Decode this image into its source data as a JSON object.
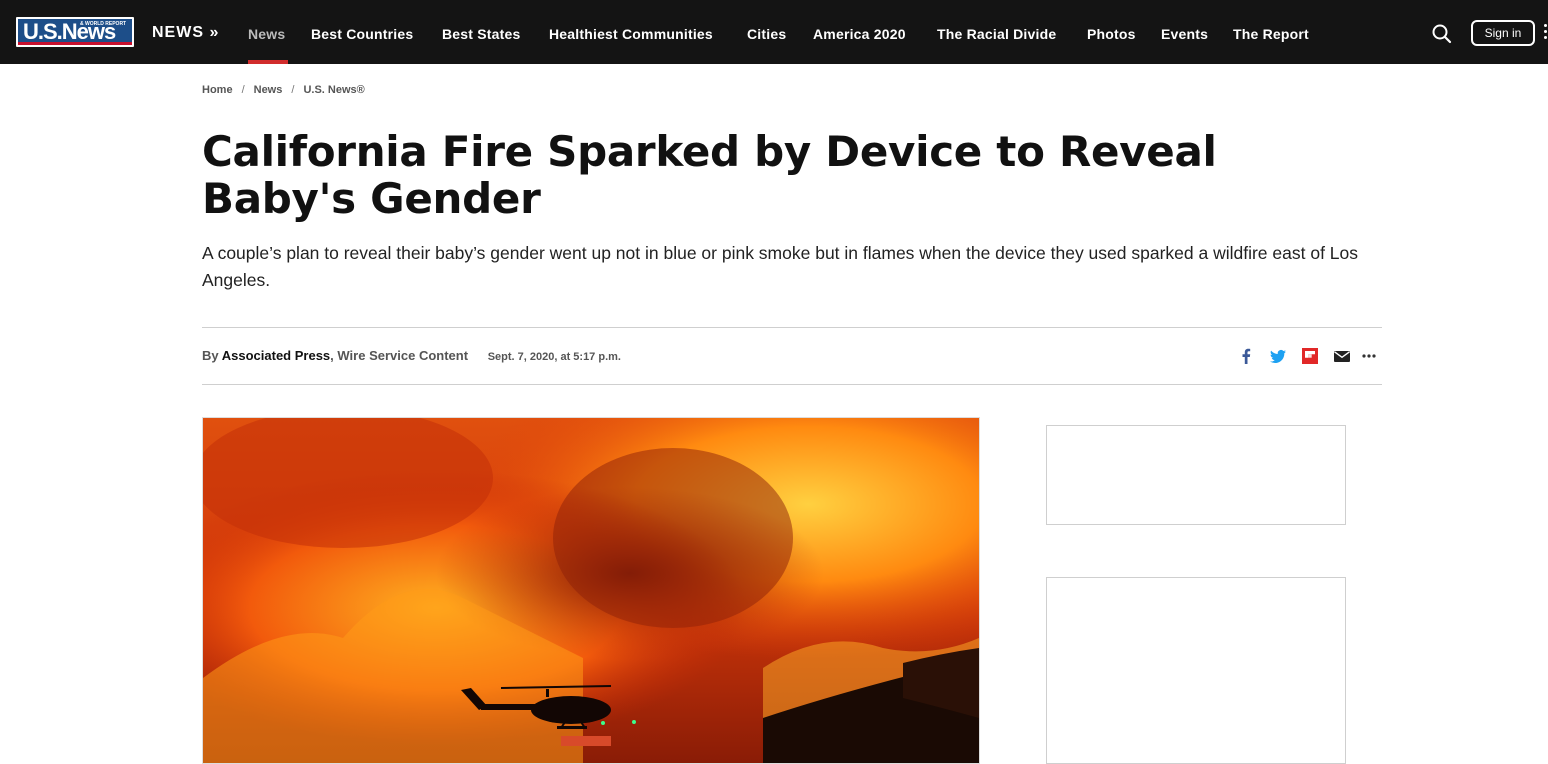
{
  "nav": {
    "logo_text": "U.S.News",
    "logo_subtext": "& WORLD REPORT",
    "brand": "NEWS »",
    "items": [
      {
        "label": "News",
        "active": true
      },
      {
        "label": "Best Countries"
      },
      {
        "label": "Best States"
      },
      {
        "label": "Healthiest Communities"
      },
      {
        "label": "Cities"
      },
      {
        "label": "America 2020"
      },
      {
        "label": "The Racial Divide"
      },
      {
        "label": "Photos"
      },
      {
        "label": "Events"
      },
      {
        "label": "The Report"
      }
    ],
    "sign_in": "Sign in",
    "search_icon": "search-icon",
    "active_color": "#d12c2c"
  },
  "breadcrumb": [
    "Home",
    "News",
    "U.S. News®"
  ],
  "article": {
    "title": "California Fire Sparked by Device to Reveal Baby's Gender",
    "deck": "A couple’s plan to reveal their baby’s gender went up not in blue or pink smoke but in flames when the device they used sparked a wildfire east of Los Angeles.",
    "byline_prefix": "By",
    "author": "Associated Press",
    "separator": ", ",
    "wire": "Wire Service Content",
    "date": "Sept. 7, 2020, at 5:17 p.m."
  },
  "share": {
    "icons": [
      "facebook-icon",
      "twitter-icon",
      "flipboard-icon",
      "email-icon",
      "more-icon"
    ],
    "facebook_color": "#3b5998",
    "twitter_color": "#1da1f2",
    "flipboard_color": "#e12828"
  }
}
